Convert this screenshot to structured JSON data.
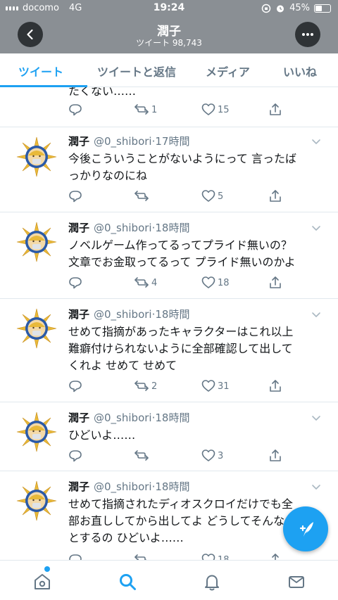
{
  "status_bar": {
    "carrier": "docomo",
    "network": "4G",
    "time": "19:24",
    "battery": "45%"
  },
  "profile": {
    "name": "潤子",
    "tweet_count": "ツイート 98,743"
  },
  "tabs": [
    {
      "label": "ツイート"
    },
    {
      "label": "ツイートと返信"
    },
    {
      "label": "メディア"
    },
    {
      "label": "いいね"
    }
  ],
  "partial_tweet": {
    "text": "たくない……",
    "retweets": "1",
    "likes": "15"
  },
  "tweets": [
    {
      "name": "潤子",
      "handle": "@0_shibori",
      "time": "17時間",
      "text": "今後こういうことがないようにって 言ったば\nっかりなのにね",
      "replies": "",
      "retweets": "",
      "likes": "5"
    },
    {
      "name": "潤子",
      "handle": "@0_shibori",
      "time": "18時間",
      "text": "ノベルゲーム作ってるってプライド無いの？\n文章でお金取ってるって プライド無いのかよ",
      "replies": "",
      "retweets": "4",
      "likes": "18"
    },
    {
      "name": "潤子",
      "handle": "@0_shibori",
      "time": "18時間",
      "text": "せめて指摘があったキャラクターはこれ以上\n難癖付けられないように全部確認して出して\nくれよ せめて せめて",
      "replies": "",
      "retweets": "2",
      "likes": "31"
    },
    {
      "name": "潤子",
      "handle": "@0_shibori",
      "time": "18時間",
      "text": "ひどいよ……",
      "replies": "",
      "retweets": "",
      "likes": "3"
    },
    {
      "name": "潤子",
      "handle": "@0_shibori",
      "time": "18時間",
      "text": "せめて指摘されたディオスクロイだけでも全\n部お直ししてから出してよ どうしてそんなこ\nとするの ひどいよ……",
      "replies": "",
      "retweets": "",
      "likes": "18"
    }
  ],
  "colors": {
    "accent": "#1da1f2",
    "header_bg": "#8a8f94",
    "muted": "#657786"
  },
  "icons": [
    "back-arrow-icon",
    "more-icon",
    "reply-icon",
    "retweet-icon",
    "like-icon",
    "share-icon",
    "caret-down-icon",
    "compose-icon",
    "home-icon",
    "search-icon",
    "notifications-icon",
    "messages-icon"
  ]
}
